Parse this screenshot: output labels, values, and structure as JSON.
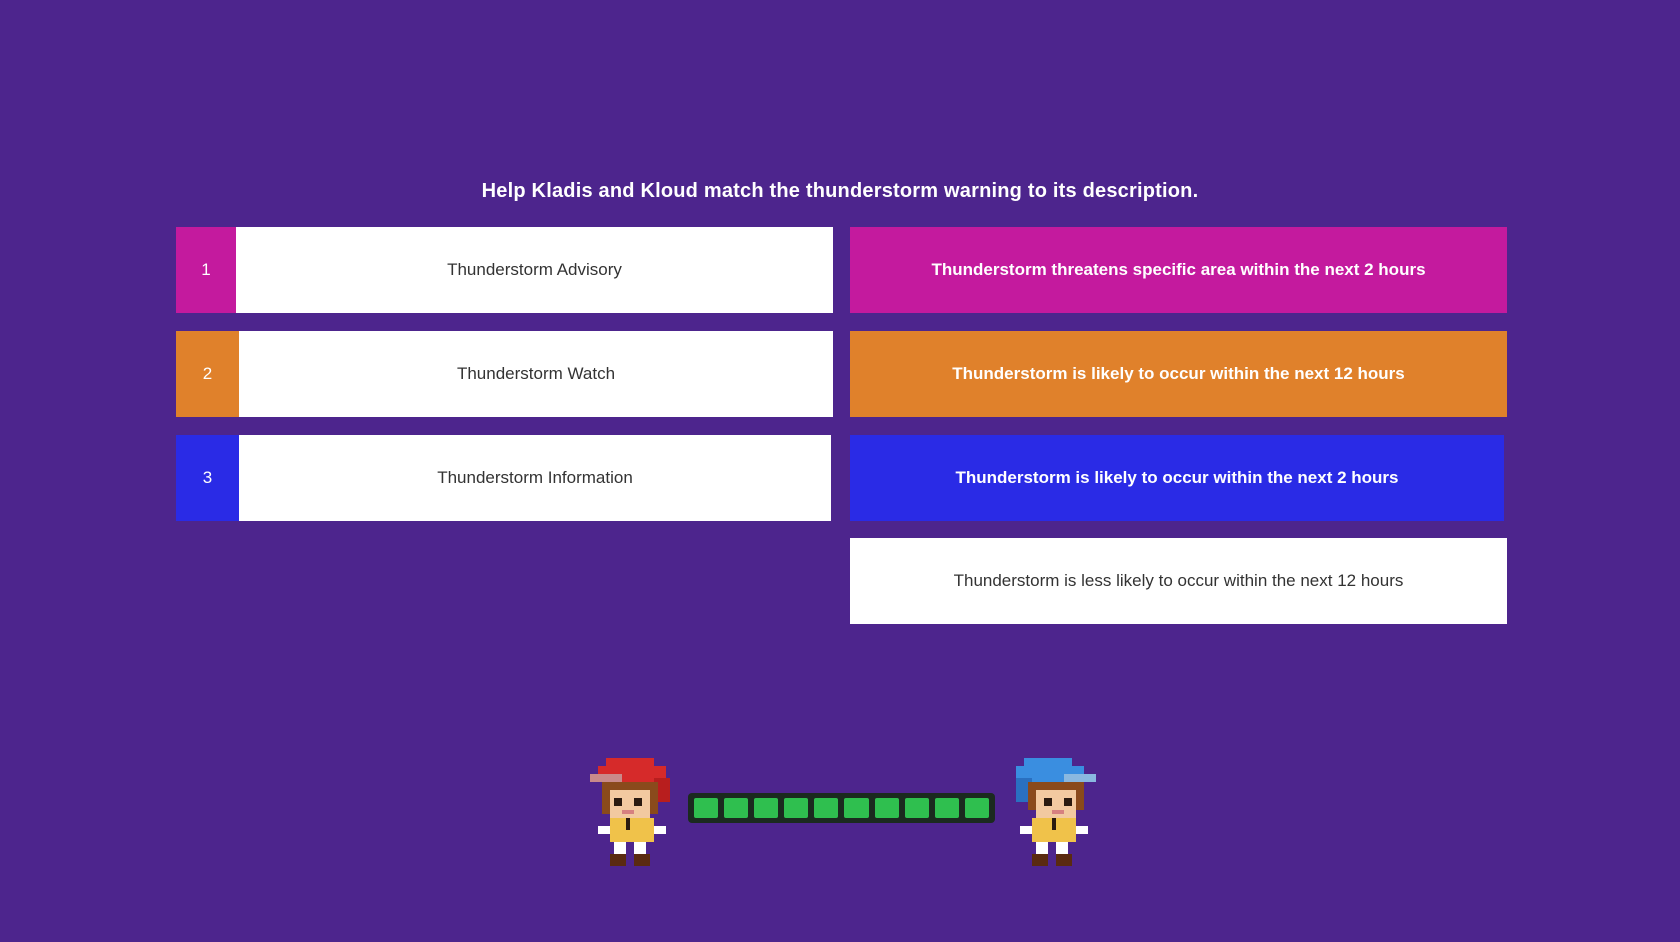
{
  "instruction": "Help Kladis and Kloud match the thunderstorm warning to its description.",
  "terms": [
    {
      "number": "1",
      "label": "Thunderstorm Advisory",
      "color": "#c41a9e"
    },
    {
      "number": "2",
      "label": "Thunderstorm Watch",
      "color": "#e0812b"
    },
    {
      "number": "3",
      "label": "Thunderstorm Information",
      "color": "#2a2be6"
    }
  ],
  "descriptions": [
    {
      "text": "Thunderstorm threatens specific area within the next 2 hours",
      "color": "#c41a9e"
    },
    {
      "text": "Thunderstorm is likely to occur within the next 12 hours",
      "color": "#e0812b"
    },
    {
      "text": "Thunderstorm is likely to occur within the next 2 hours",
      "color": "#2a2be6"
    },
    {
      "text": "Thunderstorm is less likely to occur within the next 12 hours",
      "color": "#ffffff"
    }
  ],
  "progress": {
    "filled_segments": 10,
    "total_segments": 10,
    "color": "#2fbf4f"
  },
  "characters": {
    "left": {
      "hat_color": "#d62a2a",
      "icon": "kladis-sprite-icon"
    },
    "right": {
      "hat_color": "#3a8ee0",
      "icon": "kloud-sprite-icon"
    }
  }
}
